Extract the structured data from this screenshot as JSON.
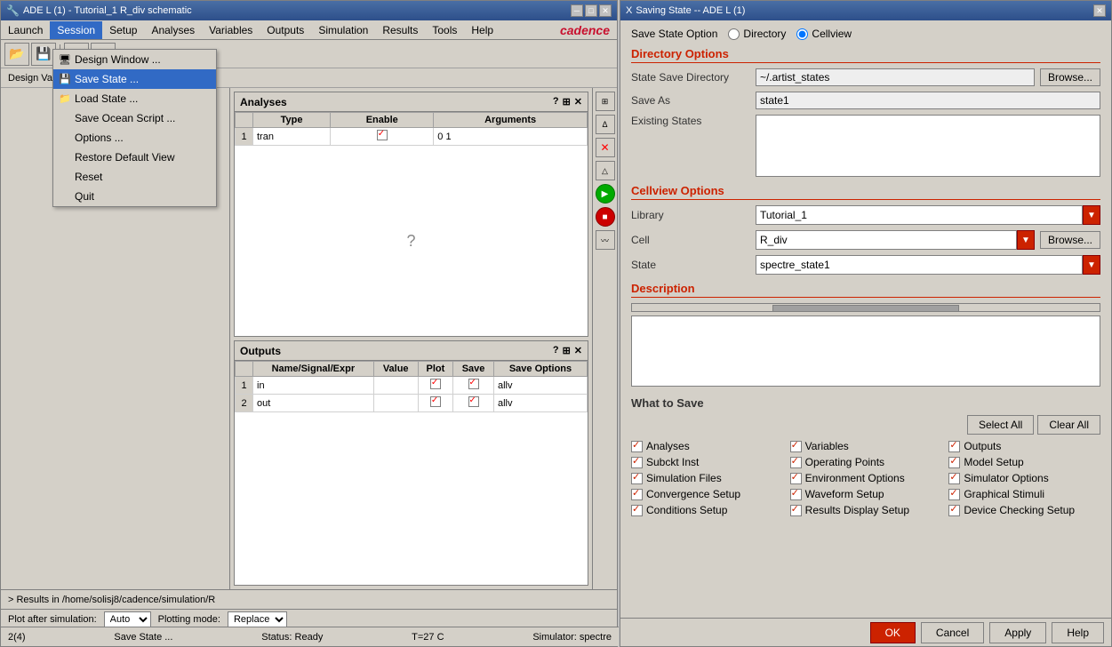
{
  "ade_window": {
    "title": "ADE L (1) - Tutorial_1 R_div schematic",
    "menubar": {
      "items": [
        "Launch",
        "Session",
        "Setup",
        "Analyses",
        "Variables",
        "Outputs",
        "Simulation",
        "Results",
        "Tools",
        "Help"
      ]
    },
    "session_menu": {
      "items": [
        {
          "label": "Design Window ...",
          "icon": "🖥"
        },
        {
          "label": "Save State ...",
          "icon": "💾",
          "highlighted": true
        },
        {
          "label": "Load State ...",
          "icon": "📁"
        },
        {
          "label": "Save Ocean Script ...",
          "icon": ""
        },
        {
          "label": "Options ...",
          "icon": ""
        },
        {
          "label": "Restore Default View",
          "icon": ""
        },
        {
          "label": "Reset",
          "icon": ""
        },
        {
          "label": "Quit",
          "icon": ""
        }
      ]
    },
    "analyses_panel": {
      "title": "Analyses",
      "columns": [
        "",
        "Type",
        "Enable",
        "Arguments"
      ],
      "rows": [
        {
          "num": "1",
          "type": "tran",
          "enable": true,
          "arguments": "0 1"
        }
      ]
    },
    "outputs_panel": {
      "title": "Outputs",
      "columns": [
        "",
        "Name/Signal/Expr",
        "Value",
        "Plot",
        "Save",
        "Save Options"
      ],
      "rows": [
        {
          "num": "1",
          "name": "in",
          "value": "",
          "plot": true,
          "save": false,
          "save_options": "allv"
        },
        {
          "num": "2",
          "name": "out",
          "value": "",
          "plot": true,
          "save": false,
          "save_options": "allv"
        }
      ]
    },
    "status_bar": {
      "text": "> Results in /home/solisj8/cadence/simulation/R",
      "plot_after_sim_label": "Plot after simulation:",
      "plot_after_sim_value": "Auto",
      "plotting_mode_label": "Plotting mode:",
      "plotting_mode_value": "Replace"
    },
    "bottom_bar": {
      "tab": "2(4)",
      "status": "Save State ...",
      "ready": "Status: Ready",
      "temp": "T=27 C",
      "simulator": "Simulator: spectre"
    }
  },
  "saving_dialog": {
    "title": "Saving State -- ADE L (1)",
    "save_state_option_label": "Save State Option",
    "radio_directory": "Directory",
    "radio_cellview": "Cellview",
    "radio_cellview_selected": true,
    "directory_options": {
      "header": "Directory Options",
      "state_save_dir_label": "State Save Directory",
      "state_save_dir_value": "~/.artist_states",
      "save_as_label": "Save As",
      "save_as_value": "state1",
      "existing_states_label": "Existing States"
    },
    "cellview_options": {
      "header": "Cellview Options",
      "library_label": "Library",
      "library_value": "Tutorial_1",
      "cell_label": "Cell",
      "cell_value": "R_div",
      "state_label": "State",
      "state_value": "spectre_state1",
      "browse_label": "Browse..."
    },
    "description": {
      "header": "Description"
    },
    "what_to_save": {
      "header": "What to Save",
      "select_all": "Select All",
      "clear_all": "Clear All",
      "items": [
        {
          "label": "Analyses",
          "checked": true
        },
        {
          "label": "Variables",
          "checked": true
        },
        {
          "label": "Outputs",
          "checked": true
        },
        {
          "label": "Subckt Inst",
          "checked": true
        },
        {
          "label": "Operating Points",
          "checked": true
        },
        {
          "label": "Model Setup",
          "checked": true
        },
        {
          "label": "Simulation Files",
          "checked": true
        },
        {
          "label": "Environment Options",
          "checked": true
        },
        {
          "label": "Simulator Options",
          "checked": true
        },
        {
          "label": "Convergence Setup",
          "checked": true
        },
        {
          "label": "Waveform Setup",
          "checked": true
        },
        {
          "label": "Graphical Stimuli",
          "checked": true
        },
        {
          "label": "Conditions Setup",
          "checked": true
        },
        {
          "label": "Results Display Setup",
          "checked": true
        },
        {
          "label": "Device Checking Setup",
          "checked": true
        }
      ]
    },
    "footer": {
      "ok": "OK",
      "cancel": "Cancel",
      "apply": "Apply",
      "help": "Help"
    }
  }
}
